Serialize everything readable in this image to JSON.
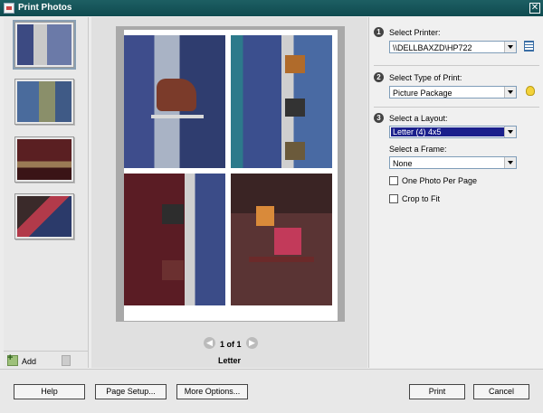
{
  "window": {
    "title": "Print Photos",
    "close_symbol": "✕"
  },
  "thumbnails": [
    "photo-1",
    "photo-2",
    "photo-3",
    "photo-4"
  ],
  "thumbnail_pane": {
    "add_label": "Add"
  },
  "preview": {
    "page_indicator": "1 of 1",
    "paper_size": "Letter",
    "prev_symbol": "◀",
    "next_symbol": "▶"
  },
  "options": {
    "step1": {
      "number": "1",
      "label": "Select Printer:",
      "value": "\\\\DELLBAXZD\\HP722"
    },
    "step2": {
      "number": "2",
      "label": "Select Type of Print:",
      "value": "Picture Package"
    },
    "step3": {
      "number": "3",
      "label": "Select a Layout:",
      "value": "Letter (4) 4x5"
    },
    "frame": {
      "label": "Select a Frame:",
      "value": "None"
    },
    "one_per_page": "One Photo Per Page",
    "crop_to_fit": "Crop to Fit"
  },
  "buttons": {
    "help": "Help",
    "page_setup": "Page Setup...",
    "more_options": "More Options...",
    "print": "Print",
    "cancel": "Cancel"
  }
}
